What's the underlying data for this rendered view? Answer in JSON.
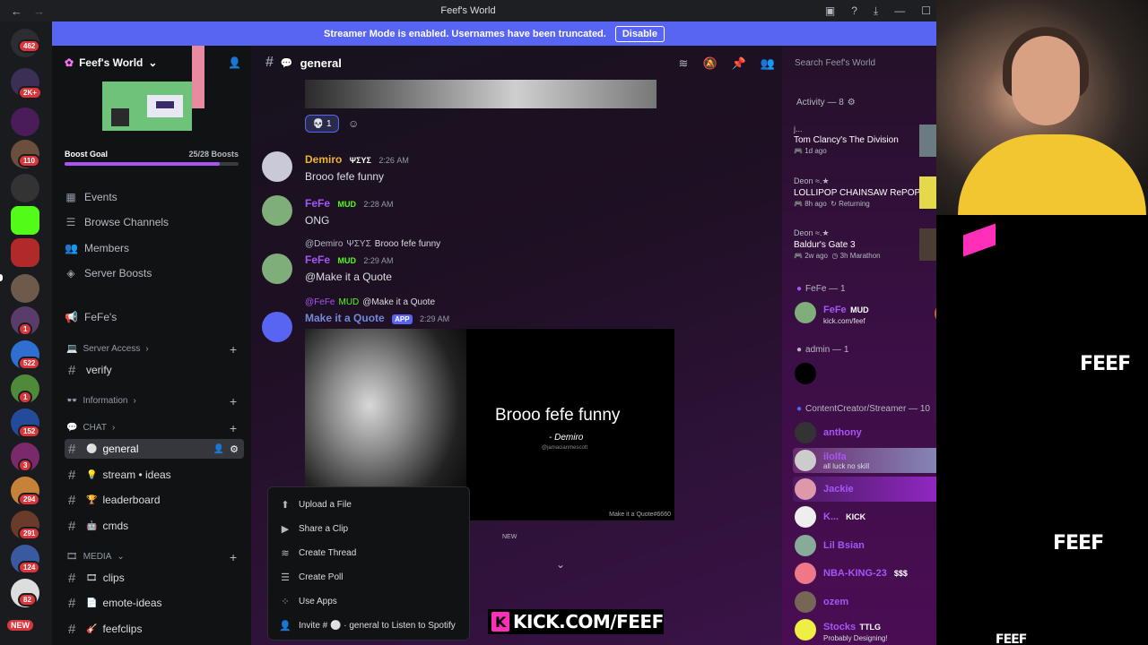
{
  "titlebar": {
    "title": "Feef's World",
    "back": "←",
    "forward": "→"
  },
  "rail": {
    "badges": [
      "462",
      "2K+",
      "110",
      "1",
      "1",
      "522",
      "1",
      "152",
      "3",
      "294",
      "291",
      "124",
      "82"
    ],
    "new_label": "NEW"
  },
  "banner": {
    "text": "Streamer Mode is enabled. Usernames have been truncated.",
    "button": "Disable"
  },
  "sidebar": {
    "server_name": "Feef's World",
    "boost_label": "Boost Goal",
    "boost_count": "25/28 Boosts",
    "boost_progress": 0.89,
    "nav": [
      "Events",
      "Browse Channels",
      "Members",
      "Server Boosts"
    ],
    "fefes": "FeFe's",
    "categories": {
      "server_access": "Server Access",
      "information": "Information",
      "chat": "CHAT",
      "media": "MEDIA"
    },
    "channels": {
      "verify": "verify",
      "general": "general",
      "stream_ideas": "stream • ideas",
      "leaderboard": "leaderboard",
      "cmds": "cmds",
      "clips": "clips",
      "emote_ideas": "emote-ideas",
      "feefclips": "feefclips"
    }
  },
  "chat": {
    "channel": "general",
    "reaction_count": "1",
    "messages": [
      {
        "user": "Demiro",
        "tag": "ΨΣΥΣ",
        "time": "2:26 AM",
        "text": "Brooo fefe funny",
        "color": "#f0b232"
      },
      {
        "user": "FeFe",
        "tag": "MUD",
        "time": "2:28 AM",
        "text": "ONG",
        "color": "#a855f7"
      },
      {
        "reply_user": "@Demiro",
        "reply_tag": "ΨΣΥΣ",
        "reply_text": "Brooo fefe funny",
        "user": "FeFe",
        "tag": "MUD",
        "time": "2:29 AM",
        "text": "@Make it a Quote",
        "color": "#a855f7"
      },
      {
        "reply_user": "@FeFe",
        "reply_tag": "MUD",
        "reply_text": "@Make it a Quote",
        "user": "Make it a Quote",
        "tag": "APP",
        "time": "2:29 AM",
        "color": "#5865f2"
      }
    ],
    "quote": {
      "text": "Brooo fefe funny",
      "author": "- Demiro",
      "handle": "@jamacianmescott",
      "footer": "Make it a Quote#6660"
    },
    "new_label": "NEW",
    "menu": [
      "Upload a File",
      "Share a Clip",
      "Create Thread",
      "Create Poll",
      "Use Apps",
      "Invite # ⚪ · general to Listen to Spotify"
    ],
    "kick_text": "KICK.COM/FEEF"
  },
  "members": {
    "search_placeholder": "Search Feef's World",
    "activity_header": "Activity — 8",
    "activities": [
      {
        "user": "j...",
        "game": "Tom Clancy's The Division",
        "time": "1d ago"
      },
      {
        "user": "Deon ≈.★",
        "game": "LOLLIPOP CHAINSAW RePOP",
        "time": "8h ago",
        "extra": "Returning"
      },
      {
        "user": "Deon ≈.★",
        "game": "Baldur's Gate 3",
        "time": "2w ago",
        "extra": "3h Marathon"
      }
    ],
    "fefe_header": "FeFe — 1",
    "fefe_member": {
      "name": "FeFe",
      "tag": "MUD",
      "sub": "kick.com/feef"
    },
    "admin_header": "admin — 1",
    "cc_header": "ContentCreator/Streamer — 10",
    "cc_members": [
      {
        "name": "anthony",
        "color": "#a855f7"
      },
      {
        "name": "ilolfa",
        "sub": "all luck no skill",
        "color": "#a855f7"
      },
      {
        "name": "Jackie",
        "color": "#a855f7"
      },
      {
        "name": "K...",
        "tag": "KICK",
        "color": "#a855f7"
      },
      {
        "name": "Lil Bsian",
        "color": "#a855f7"
      },
      {
        "name": "NBA-KING-23",
        "tag": "$$$",
        "color": "#a855f7"
      },
      {
        "name": "ozem",
        "color": "#a855f7"
      },
      {
        "name": "Stocks",
        "tag": "TTLG",
        "sub": "Probably Designing!",
        "color": "#a855f7"
      }
    ]
  },
  "stream": {
    "feef_text": "FEEF"
  }
}
